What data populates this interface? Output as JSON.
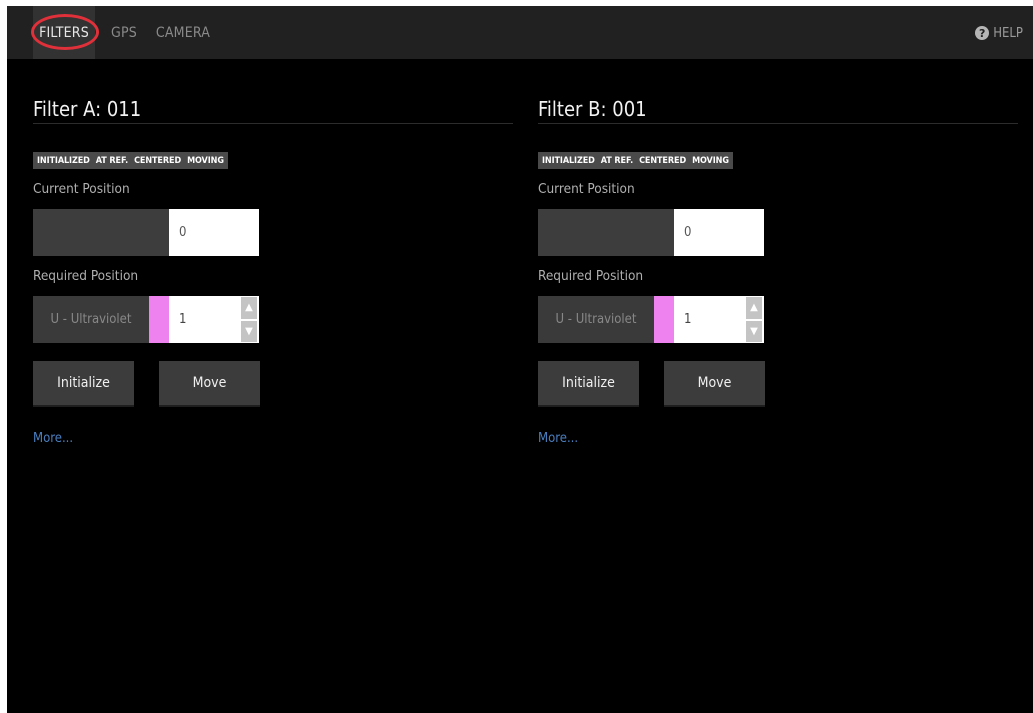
{
  "nav": {
    "tabs": [
      {
        "label": "FILTERS",
        "active": true
      },
      {
        "label": "GPS",
        "active": false
      },
      {
        "label": "CAMERA",
        "active": false
      }
    ],
    "help_label": "HELP",
    "help_icon": "question-circle-icon",
    "highlight_color": "#e0303a"
  },
  "filters": [
    {
      "title": "Filter A: 011",
      "status_flags": [
        "INITIALIZED",
        "AT REF.",
        "CENTERED",
        "MOVING"
      ],
      "current_position_label": "Current Position",
      "current_position_value": "0",
      "required_position_label": "Required Position",
      "filter_name": "U - Ultraviolet",
      "filter_color": "#ee82ee",
      "required_position_value": "1",
      "initialize_label": "Initialize",
      "move_label": "Move",
      "more_label": "More..."
    },
    {
      "title": "Filter B: 001",
      "status_flags": [
        "INITIALIZED",
        "AT REF.",
        "CENTERED",
        "MOVING"
      ],
      "current_position_label": "Current Position",
      "current_position_value": "0",
      "required_position_label": "Required Position",
      "filter_name": "U - Ultraviolet",
      "filter_color": "#ee82ee",
      "required_position_value": "1",
      "initialize_label": "Initialize",
      "move_label": "Move",
      "more_label": "More..."
    }
  ]
}
